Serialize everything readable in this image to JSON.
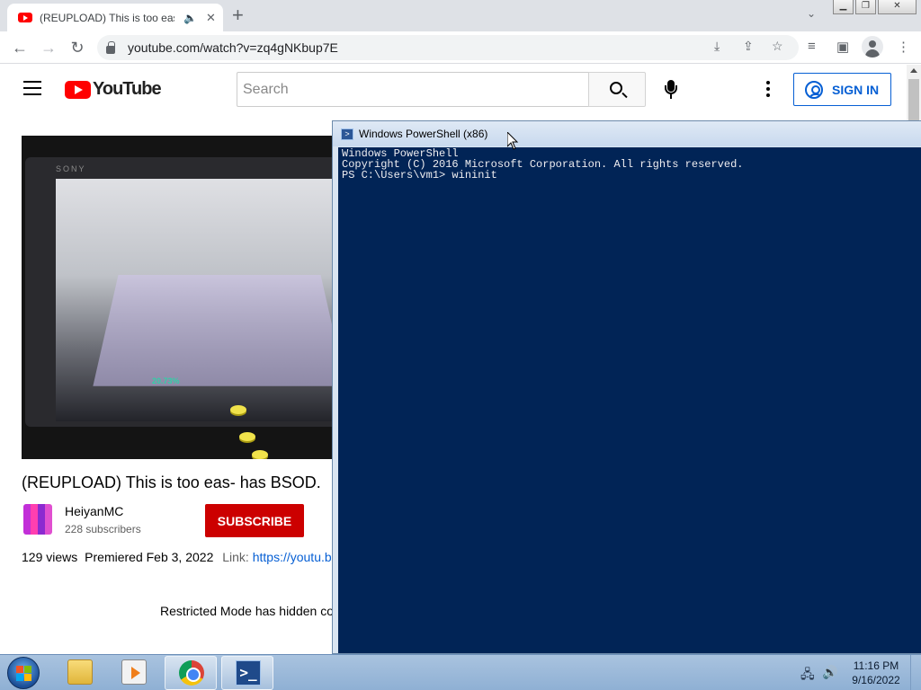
{
  "browser": {
    "tab": {
      "title": "(REUPLOAD) This is too eas-",
      "audio_icon": "speaker-icon",
      "close_label": "✕"
    },
    "new_tab_label": "+",
    "tab_search_label": "⌄",
    "window_controls": {
      "minimize": "▁",
      "restore": "❐",
      "close": "✕"
    },
    "nav": {
      "back": "←",
      "forward": "→",
      "reload": "↻"
    },
    "address": {
      "url": "youtube.com/watch?v=zq4gNKbup7E"
    },
    "toolbar_icons": {
      "install": "⤓",
      "share": "⇪",
      "bookmark": "☆",
      "media": "≡",
      "side_panel": "▣",
      "menu": "⋮"
    }
  },
  "youtube": {
    "logo_text": "YouTube",
    "search": {
      "placeholder": "Search"
    },
    "sign_in_label": "SIGN IN",
    "video": {
      "title": "(REUPLOAD) This is too eas- has BSOD.",
      "channel_name": "HeiyanMC",
      "subscribers": "228 subscribers",
      "subscribe_label": "SUBSCRIBE",
      "views": "129 views",
      "premiered": "Premiered Feb 3, 2022",
      "link_label": "Link:",
      "link_url": "https://youtu.be",
      "restricted_notice": "Restricted Mode has hidden co",
      "thumbnail_texts": {
        "brand": "SONY",
        "score": "20.73%"
      }
    }
  },
  "powershell": {
    "title": "Windows PowerShell (x86)",
    "lines": [
      "Windows PowerShell",
      "Copyright (C) 2016 Microsoft Corporation. All rights reserved.",
      "",
      "PS C:\\Users\\vm1> wininit"
    ]
  },
  "taskbar": {
    "items": [
      "start-orb",
      "file-explorer",
      "media-player",
      "google-chrome",
      "windows-powershell"
    ],
    "active_items": [
      "google-chrome",
      "windows-powershell"
    ],
    "clock": {
      "time": "11:16 PM",
      "date": "9/16/2022"
    }
  },
  "colors": {
    "youtube_red": "#ff0000",
    "subscribe_red": "#cc0000",
    "link_blue": "#065fd4",
    "ps_background": "#012456"
  }
}
